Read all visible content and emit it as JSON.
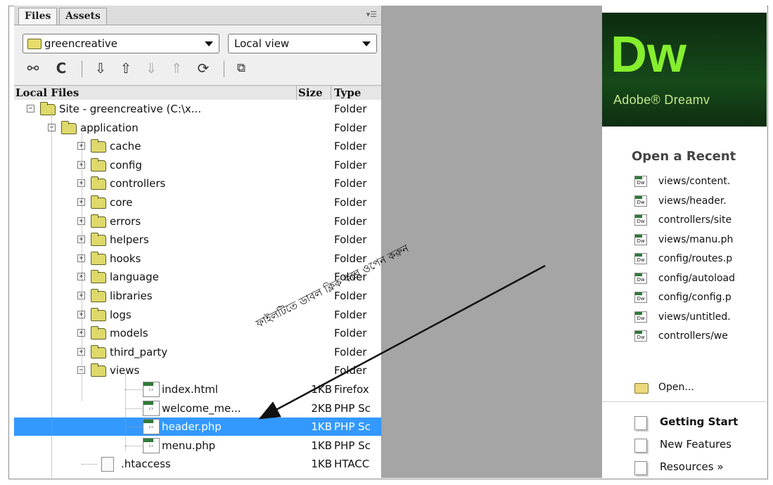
{
  "files_panel": {
    "tabs": [
      "Files",
      "Assets"
    ],
    "panel_menu_icon": "panel-menu-icon",
    "site_select": {
      "value": "greencreative",
      "icon": "folder-icon"
    },
    "view_select": {
      "value": "Local view"
    },
    "toolbar_icons": [
      "connect-icon",
      "refresh-icon",
      "get-files-icon",
      "put-files-icon",
      "check-out-icon",
      "check-in-icon",
      "synchronize-icon",
      "expand-icon"
    ],
    "columns": {
      "local": "Local Files",
      "size": "Size",
      "type": "Type"
    },
    "tree": [
      {
        "name": "Site - greencreative (C:\\x...",
        "size": "",
        "type": "Folder",
        "level": 0,
        "kind": "folder",
        "expander": "−"
      },
      {
        "name": "application",
        "size": "",
        "type": "Folder",
        "level": 1,
        "kind": "folder",
        "expander": "−"
      },
      {
        "name": "cache",
        "size": "",
        "type": "Folder",
        "level": 2,
        "kind": "folder",
        "expander": "+"
      },
      {
        "name": "config",
        "size": "",
        "type": "Folder",
        "level": 2,
        "kind": "folder",
        "expander": "+"
      },
      {
        "name": "controllers",
        "size": "",
        "type": "Folder",
        "level": 2,
        "kind": "folder",
        "expander": "+"
      },
      {
        "name": "core",
        "size": "",
        "type": "Folder",
        "level": 2,
        "kind": "folder",
        "expander": "+"
      },
      {
        "name": "errors",
        "size": "",
        "type": "Folder",
        "level": 2,
        "kind": "folder",
        "expander": "+"
      },
      {
        "name": "helpers",
        "size": "",
        "type": "Folder",
        "level": 2,
        "kind": "folder",
        "expander": "+"
      },
      {
        "name": "hooks",
        "size": "",
        "type": "Folder",
        "level": 2,
        "kind": "folder",
        "expander": "+"
      },
      {
        "name": "language",
        "size": "",
        "type": "Folder",
        "level": 2,
        "kind": "folder",
        "expander": "+"
      },
      {
        "name": "libraries",
        "size": "",
        "type": "Folder",
        "level": 2,
        "kind": "folder",
        "expander": "+"
      },
      {
        "name": "logs",
        "size": "",
        "type": "Folder",
        "level": 2,
        "kind": "folder",
        "expander": "+"
      },
      {
        "name": "models",
        "size": "",
        "type": "Folder",
        "level": 2,
        "kind": "folder",
        "expander": "+"
      },
      {
        "name": "third_party",
        "size": "",
        "type": "Folder",
        "level": 2,
        "kind": "folder",
        "expander": "+"
      },
      {
        "name": "views",
        "size": "",
        "type": "Folder",
        "level": 2,
        "kind": "folder",
        "expander": "−"
      },
      {
        "name": "index.html",
        "size": "1KB",
        "type": "Firefox",
        "level": 3,
        "kind": "dwfile"
      },
      {
        "name": "welcome_me...",
        "size": "2KB",
        "type": "PHP Sc",
        "level": 3,
        "kind": "dwfile"
      },
      {
        "name": "header.php",
        "size": "1KB",
        "type": "PHP Sc",
        "level": 3,
        "kind": "dwfile",
        "selected": true
      },
      {
        "name": "menu.php",
        "size": "1KB",
        "type": "PHP Sc",
        "level": 3,
        "kind": "dwfile"
      },
      {
        "name": ".htaccess",
        "size": "1KB",
        "type": "HTACC",
        "level": 1,
        "kind": "file"
      }
    ]
  },
  "welcome": {
    "logo": "Dw",
    "product_name": "Adobe® Dreamv",
    "recent_heading": "Open a Recent",
    "recent_files": [
      "views/content.",
      "views/header.",
      "controllers/site",
      "views/manu.ph",
      "config/routes.p",
      "config/autoload",
      "config/config.p",
      "views/untitled.",
      "controllers/we"
    ],
    "dw_icon_text": "Dw",
    "open_label": "Open...",
    "bottom_items": [
      "Getting Start",
      "New Features",
      "Resources »"
    ]
  },
  "annotation": {
    "text": "ফাইলটিতে ডাবল ক্লিক করে ওপেন করুন",
    "color": "#111111"
  },
  "colors": {
    "selection": "#3399ff",
    "dw_green": "#86ee2e",
    "banner_dark": "#0d2b10",
    "gray_area": "#a5a5a5"
  }
}
